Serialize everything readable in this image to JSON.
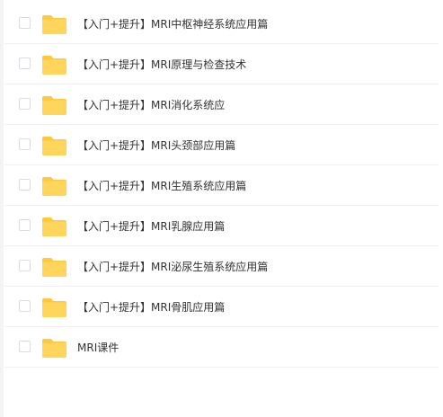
{
  "files": [
    {
      "name": "【入门+提升】MRI中枢神经系统应用篇",
      "type": "folder",
      "icon": "folder-icon"
    },
    {
      "name": "【入门+提升】MRI原理与检查技术",
      "type": "folder",
      "icon": "folder-icon"
    },
    {
      "name": "【入门+提升】MRI消化系统应",
      "type": "folder",
      "icon": "folder-icon"
    },
    {
      "name": "【入门+提升】MRI头颈部应用篇",
      "type": "folder",
      "icon": "folder-icon"
    },
    {
      "name": "【入门+提升】MRI生殖系统应用篇",
      "type": "folder",
      "icon": "folder-icon"
    },
    {
      "name": "【入门+提升】MRI乳腺应用篇",
      "type": "folder",
      "icon": "folder-icon"
    },
    {
      "name": "【入门+提升】MRI泌尿生殖系统应用篇",
      "type": "folder",
      "icon": "folder-icon"
    },
    {
      "name": "【入门+提升】MRI骨肌应用篇",
      "type": "folder",
      "icon": "folder-icon"
    },
    {
      "name": "MRI课件",
      "type": "folder",
      "icon": "folder-icon"
    }
  ],
  "colors": {
    "folder": "#ffd55c",
    "folder_tab": "#ffc83d",
    "checkbox_border": "#d9dde3",
    "divider": "#f0f0f0",
    "text": "#333333"
  }
}
